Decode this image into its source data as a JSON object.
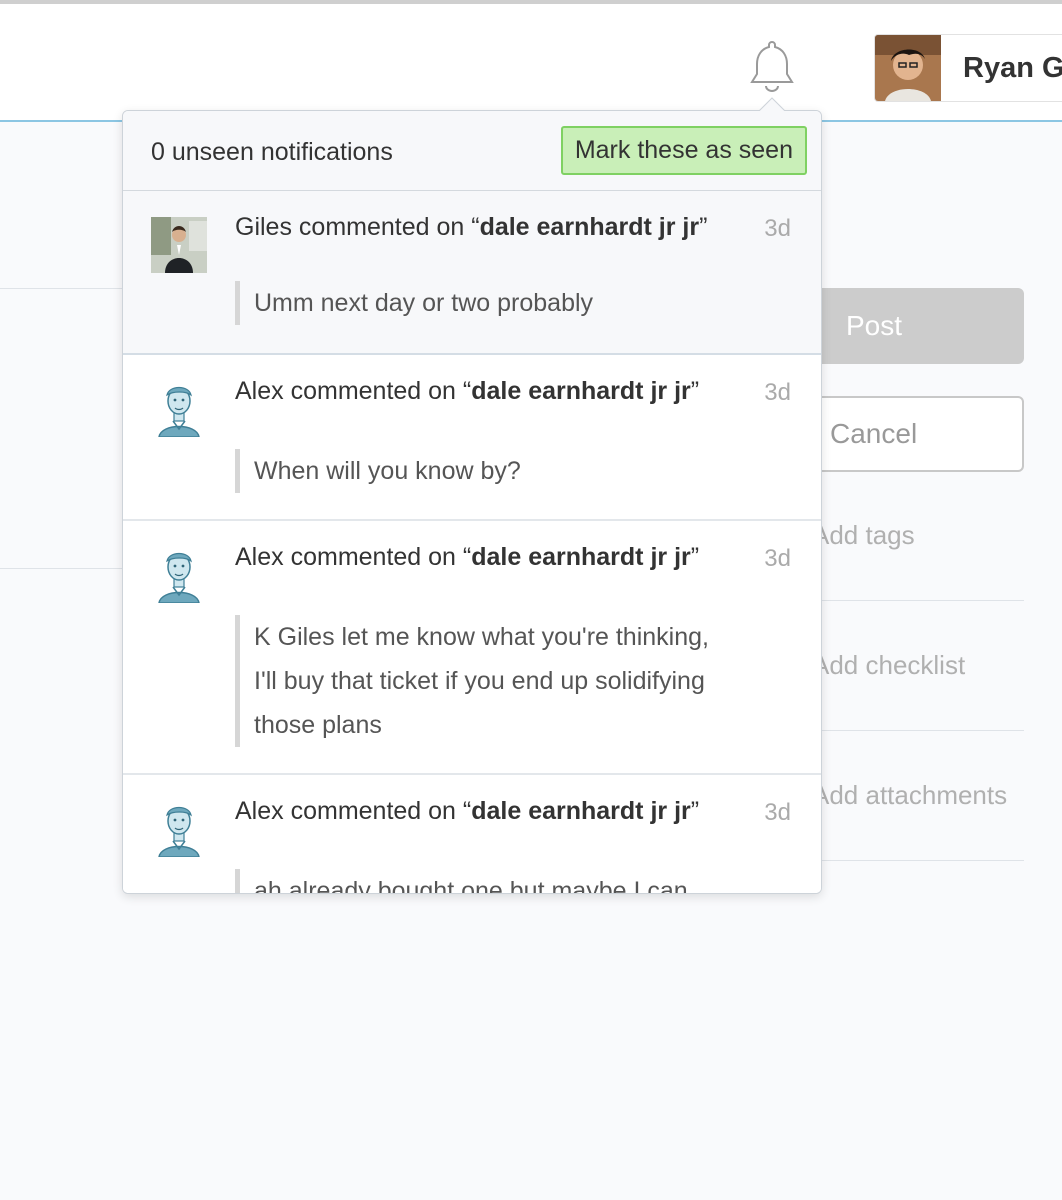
{
  "header": {
    "user_name": "Ryan Go",
    "notifications_icon": "bell-icon"
  },
  "background": {
    "post_label": "Post",
    "cancel_label": "Cancel",
    "add_tags": "Add tags",
    "add_checklist": "Add checklist",
    "add_attachments": "Add attachments"
  },
  "popover": {
    "count_text": "0 unseen notifications",
    "mark_label": "Mark these as seen",
    "notifications": [
      {
        "actor": "Giles",
        "verb": " commented on ",
        "open_quote": "“",
        "target": "dale earnhardt jr jr",
        "close_quote": "”",
        "time": "3d",
        "comment": "Umm next day or two probably"
      },
      {
        "actor": "Alex",
        "verb": " commented on ",
        "open_quote": "“",
        "target": "dale earnhardt jr jr",
        "close_quote": "”",
        "time": "3d",
        "comment": "When will you know by?"
      },
      {
        "actor": "Alex",
        "verb": " commented on ",
        "open_quote": "“",
        "target": "dale earnhardt jr jr",
        "close_quote": "”",
        "time": "3d",
        "comment": "K Giles let me know what you're thinking, I'll buy that ticket if you end up solidifying those plans"
      },
      {
        "actor": "Alex",
        "verb": " commented on ",
        "open_quote": "“",
        "target": "dale earnhardt jr jr",
        "close_quote": "”",
        "time": "3d",
        "comment": "ah already bought one but maybe I can"
      }
    ]
  },
  "colors": {
    "accent_line": "#8cc6e3",
    "mark_button_bg": "#c9efb8",
    "mark_button_border": "#7fd162"
  }
}
